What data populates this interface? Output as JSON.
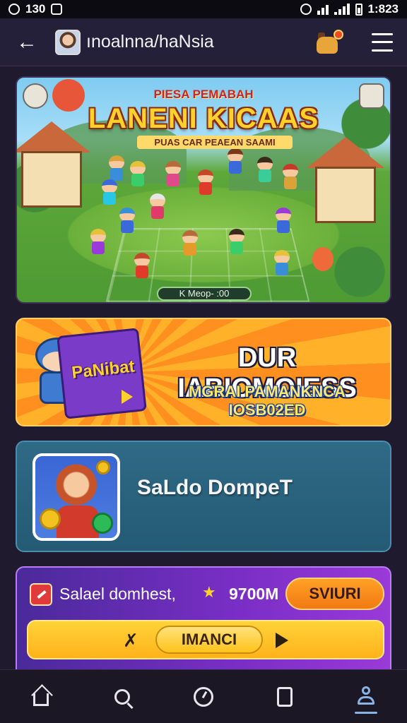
{
  "status_bar": {
    "left_text": "130",
    "time": "1:823"
  },
  "app_bar": {
    "title": "ınoalnna/haNsia",
    "icons": [
      "back-arrow-icon",
      "avatar",
      "dog-icon",
      "hamburger-menu-icon"
    ]
  },
  "hero": {
    "subtitle": "PIESA PEMABAH",
    "title": "LANENI KICAAS",
    "tagline": "PUAS CAR PEAEAN SAAMI",
    "pill_text": "K Meop- :00",
    "icons": [
      "settings-gear-icon",
      "notification-icon"
    ]
  },
  "promo": {
    "box_label": "PaNibat",
    "title": "DUR IABIOMOIESS",
    "subtitle": "MGRAI PAMANKNCA IOSB02ED",
    "icons": [
      "play-icon"
    ]
  },
  "wallet": {
    "title": "SaLdo DompeT",
    "icons": [
      "wallet-mascot-icon"
    ]
  },
  "balance": {
    "label": "Salael domhest,",
    "amount": "9700M",
    "button_label": "SVIURI",
    "action_label": "IMANCI",
    "icons": [
      "close-x-icon",
      "play-icon",
      "star-icon"
    ]
  },
  "bottom_nav": {
    "items": [
      "home-icon",
      "search-icon",
      "clock-icon",
      "page-icon",
      "profile-icon"
    ],
    "active": "profile-icon"
  },
  "colors": {
    "background": "#1f1a2e",
    "app_bar": "#25203a",
    "promo_orange": "#ff9020",
    "wallet_teal": "#2f6a86",
    "balance_purple": "#7a2ec6",
    "accent_yellow": "#ffd22b"
  }
}
